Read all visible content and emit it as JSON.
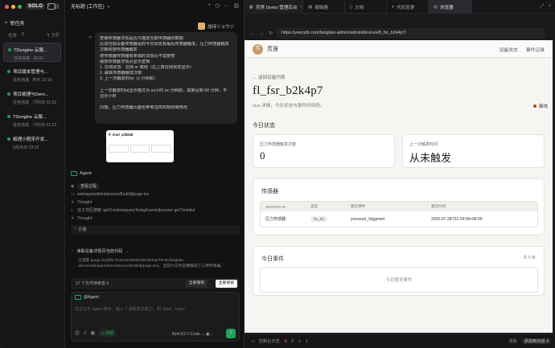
{
  "sidebar": {
    "solo_badge": "SOLO",
    "new_task": "新任务",
    "filter": "全部",
    "task_header": "任务",
    "task_count": "5",
    "tasks": [
      {
        "title": "TDengine 云服...",
        "sub": "任务完成 · 00:01"
      },
      {
        "title": "项目版本管理与...",
        "sub": "任务完成 · 昨天 23:10"
      },
      {
        "title": "项目梳理与Dem...",
        "sub": "任务完成 · 7月5日 01:23"
      },
      {
        "title": "TDengine 云服...",
        "sub": "任务完成 · 7月5日 01:13"
      },
      {
        "title": "梳理小程序开发...",
        "sub": "6月26日 23:22"
      }
    ]
  },
  "chat": {
    "title": "无标题 (工作区)",
    "user": "加持リョウジ",
    "bubble_lines": [
      "查看传感器详情是否只描述当前传感器的数据",
      "比如当前设备传感器是的今日状态有最后传感器触发，压力传感器触发",
      "次数和按传感器触发",
      "按传感器传感器有单独的详情页不需要管",
      "磁铁传感器详情页显示逻辑",
      "1. 在线状态：在线 or 离线（右上角在线状态显示）",
      "2. 磁铁传感器触发次数",
      "3. 上一次触发时间（x 分钟前）",
      "",
      "上一次触发时间显示格式为 xx小时 xx 分钟前，如果没到 60 分钟，不",
      "显示小时",
      "",
      "同理，压力传感器页面也参考这样的规则做修改"
    ],
    "thumb_title": "fl_mod_a3b8a8",
    "agent_label": "Agent",
    "steps": [
      {
        "icon": "eye",
        "text": "查看过程"
      },
      {
        "icon": "file",
        "text": "web/app/admin/devices/[hubId]/page.tsx"
      },
      {
        "icon": "brain",
        "text": "Thought"
      },
      {
        "icon": "search",
        "text": "在工作区搜索 'getTimeline|queryTodayEvents|function getTimeline'"
      },
      {
        "icon": "brain",
        "text": "Thought"
      }
    ],
    "collapse_label": "折叠",
    "read_step": "读取设备详情页当前代码",
    "read_body": "已读取 [page.tsx](file:///Users/4682b4/Desktop/TRAE/fangtian-demo/web/app/admin/devices/[hubId]/page.tsx)，当前今日状态硬编码了三种传感器，",
    "files_bar": "17 个文件待审查  0",
    "btn_undo": "全部撤销",
    "btn_keep": "全部保留",
    "mention": "@Agent",
    "placeholder": "您正在与 Agent 聊天，输入 '/' 获取更多能力，如 '/plan', '/spec'",
    "tool_chip": "∞ 流畅",
    "model": "Kimi-K2.7-Code"
  },
  "browser": {
    "tabs": [
      "芳莲 Demo 管理后台",
      "编辑器",
      "文档",
      "代码变更",
      "浏览器"
    ],
    "url": "https://yeezytb.com/fangtian-admin/admin/devices/fl_fsr_b2k4p7/",
    "status_left": "控制台日志",
    "status_errors": "0",
    "status_warnings": "1",
    "status_clear": "清除",
    "status_add": "添加到对话",
    "status_add_count": "4"
  },
  "page": {
    "logo_char": "芳",
    "brand": "芳莲",
    "nav": [
      "设备状态",
      "事件记录"
    ],
    "back": "← 返回设备列表",
    "device_id": "fl_fsr_b2k4p7",
    "subtitle": "Hub 详情，今日状态与事件时间线。",
    "online_status": "离线",
    "today_title": "今日状态",
    "cards": [
      {
        "label": "压力传感器触发次数",
        "value": "0"
      },
      {
        "label": "上一次触发时间",
        "value": "从未触发"
      }
    ],
    "sensor_title": "传感器",
    "table_headers": [
      "SENSOR ID",
      "类型",
      "最近事件",
      "最近时间"
    ],
    "table_rows": [
      {
        "id": "压力传感器",
        "type": "fsr_01",
        "event": "pressure_triggered",
        "time": "2026-07-28T23:24:58+08:00"
      }
    ],
    "events_title": "今日事件",
    "events_count": "共 0 条",
    "events_empty": "今日暂无事件"
  }
}
